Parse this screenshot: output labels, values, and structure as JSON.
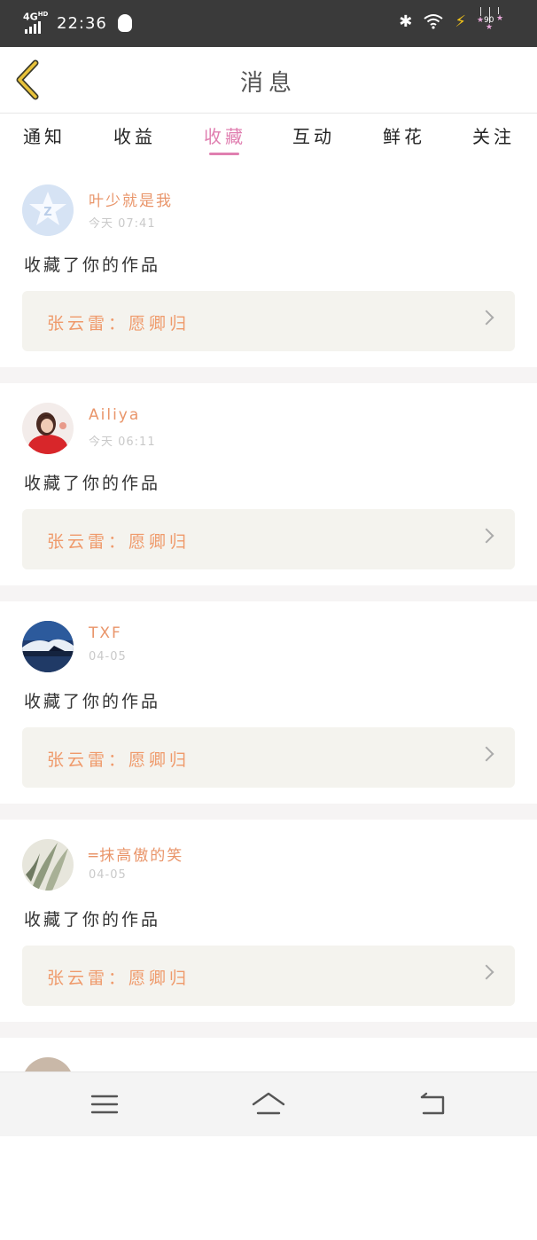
{
  "status_bar": {
    "network": "4G",
    "network_sup": "HD",
    "time": "22:36",
    "battery_level": "90"
  },
  "header": {
    "title": "消息",
    "back_icon": "back-chevron-icon"
  },
  "tabs": [
    {
      "label": "通知",
      "active": false
    },
    {
      "label": "收益",
      "active": false
    },
    {
      "label": "收藏",
      "active": true
    },
    {
      "label": "互动",
      "active": false
    },
    {
      "label": "鲜花",
      "active": false
    },
    {
      "label": "关注",
      "active": false
    }
  ],
  "colors": {
    "accent": "#e07fb0",
    "username": "#e9956a",
    "work_title": "#ef9a6b",
    "box_bg": "#f4f3ee"
  },
  "items": [
    {
      "username": "叶少就是我",
      "time": "今天 07:41",
      "action": "收藏了你的作品",
      "work": "张云雷：愿卿归",
      "avatar": "qq-default-avatar"
    },
    {
      "username": "Ailiya",
      "time": "今天 06:11",
      "action": "收藏了你的作品",
      "work": "张云雷：愿卿归",
      "avatar": "girl-photo-avatar"
    },
    {
      "username": "TXF",
      "time": "04-05",
      "action": "收藏了你的作品",
      "work": "张云雷：愿卿归",
      "avatar": "mountain-photo-avatar"
    },
    {
      "username": "═抹高傲的笑",
      "time": "04-05",
      "action": "收藏了你的作品",
      "work": "张云雷：愿卿归",
      "avatar": "leaf-photo-avatar"
    }
  ],
  "nav": {
    "menu_icon": "menu-icon",
    "home_icon": "home-icon",
    "back_icon": "back-icon"
  }
}
